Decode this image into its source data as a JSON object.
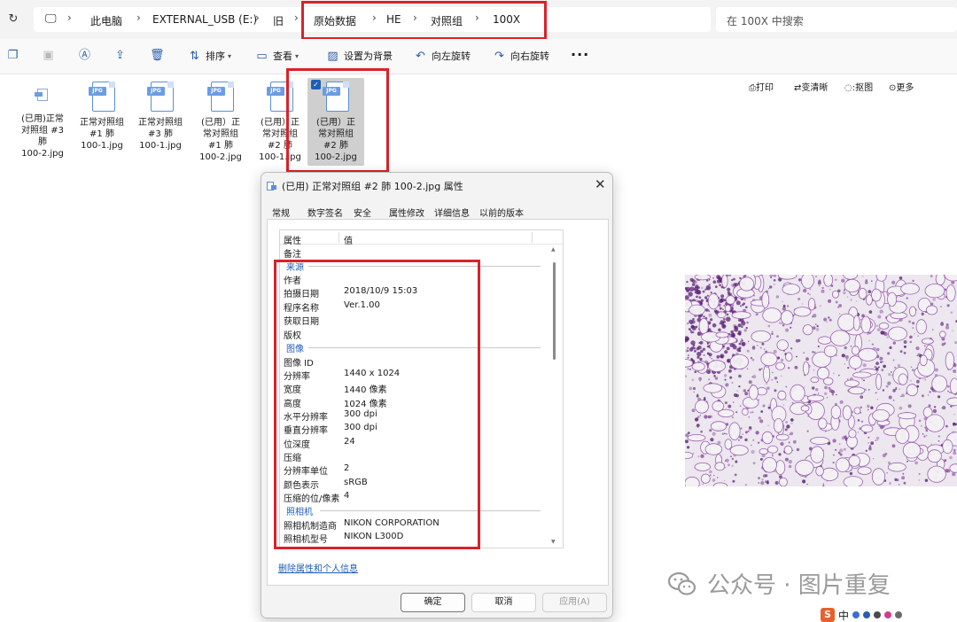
{
  "address_bar": {
    "crumbs": [
      "此电脑",
      "EXTERNAL_USB (E:)",
      "旧",
      "原始数据",
      "HE",
      "对照组",
      "100X"
    ],
    "search_placeholder": "在 100X 中搜索"
  },
  "toolbar": {
    "sort": "排序",
    "view": "查看",
    "set_background": "设置为背景",
    "rotate_left": "向左旋转",
    "rotate_right": "向右旋转",
    "more": "···"
  },
  "files": [
    {
      "name": "(已用)正常对照组 #3 肺 100-2.jpg",
      "lines": [
        "(已用)正常",
        "对照组 #3",
        "肺",
        "100-2.jpg"
      ]
    },
    {
      "name": "正常对照组 #1 肺 100-1.jpg",
      "lines": [
        "正常对照组",
        "#1 肺",
        "100-1.jpg"
      ]
    },
    {
      "name": "正常对照组 #3 肺 100-1.jpg",
      "lines": [
        "正常对照组",
        "#3 肺",
        "100-1.jpg"
      ]
    },
    {
      "name": "(已用）正常对照组 #1 肺 100-2.jpg",
      "lines": [
        "(已用）正",
        "常对照组",
        "#1 肺",
        "100-2.jpg"
      ]
    },
    {
      "name": "(已用）正常对照组 #2 肺 100-1.jpg",
      "lines": [
        "(已用）正",
        "常对照组",
        "#2 肺",
        "100-1.jpg"
      ]
    },
    {
      "name": "(已用）正常对照组 #2 肺 100-2.jpg",
      "lines": [
        "(已用）正",
        "常对照组",
        "#2 肺",
        "100-2.jpg"
      ],
      "selected": true
    }
  ],
  "file_badge": "JPG",
  "right_actions": {
    "print": "打印",
    "sharpen": "变清晰",
    "cutout": "抠图",
    "more": "更多"
  },
  "dialog": {
    "title": "(已用) 正常对照组 #2 肺 100-2.jpg 属性",
    "tabs": [
      "常规",
      "数字签名",
      "安全",
      "属性修改",
      "详细信息",
      "以前的版本"
    ],
    "active_tab": "详细信息",
    "list_headers": {
      "property": "属性",
      "value": "值"
    },
    "rows": [
      {
        "kind": "item",
        "key": "备注",
        "value": ""
      },
      {
        "kind": "group",
        "label": "来源"
      },
      {
        "kind": "item",
        "key": "作者",
        "value": ""
      },
      {
        "kind": "item",
        "key": "拍摄日期",
        "value": "2018/10/9 15:03"
      },
      {
        "kind": "item",
        "key": "程序名称",
        "value": "Ver.1.00"
      },
      {
        "kind": "item",
        "key": "获取日期",
        "value": ""
      },
      {
        "kind": "item",
        "key": "版权",
        "value": ""
      },
      {
        "kind": "group",
        "label": "图像"
      },
      {
        "kind": "item",
        "key": "图像 ID",
        "value": ""
      },
      {
        "kind": "item",
        "key": "分辨率",
        "value": "1440 x 1024"
      },
      {
        "kind": "item",
        "key": "宽度",
        "value": "1440 像素"
      },
      {
        "kind": "item",
        "key": "高度",
        "value": "1024 像素"
      },
      {
        "kind": "item",
        "key": "水平分辨率",
        "value": "300 dpi"
      },
      {
        "kind": "item",
        "key": "垂直分辨率",
        "value": "300 dpi"
      },
      {
        "kind": "item",
        "key": "位深度",
        "value": "24"
      },
      {
        "kind": "item",
        "key": "压缩",
        "value": ""
      },
      {
        "kind": "item",
        "key": "分辨率单位",
        "value": "2"
      },
      {
        "kind": "item",
        "key": "颜色表示",
        "value": "sRGB"
      },
      {
        "kind": "item",
        "key": "压缩的位/像素",
        "value": "4"
      },
      {
        "kind": "group",
        "label": "照相机"
      },
      {
        "kind": "item",
        "key": "照相机制造商",
        "value": "NIKON CORPORATION"
      },
      {
        "kind": "item",
        "key": "照相机型号",
        "value": "NIKON L300D"
      }
    ],
    "remove_link": "删除属性和个人信息",
    "buttons": {
      "ok": "确定",
      "cancel": "取消",
      "apply": "应用(A)"
    }
  },
  "watermark": {
    "text": "公众号 · 图片重复"
  },
  "ime": {
    "label": "中"
  },
  "colors": {
    "highlight_red": "#d9222a",
    "link_blue": "#1f5fb4",
    "stain_purple": "#8a4a9e"
  }
}
